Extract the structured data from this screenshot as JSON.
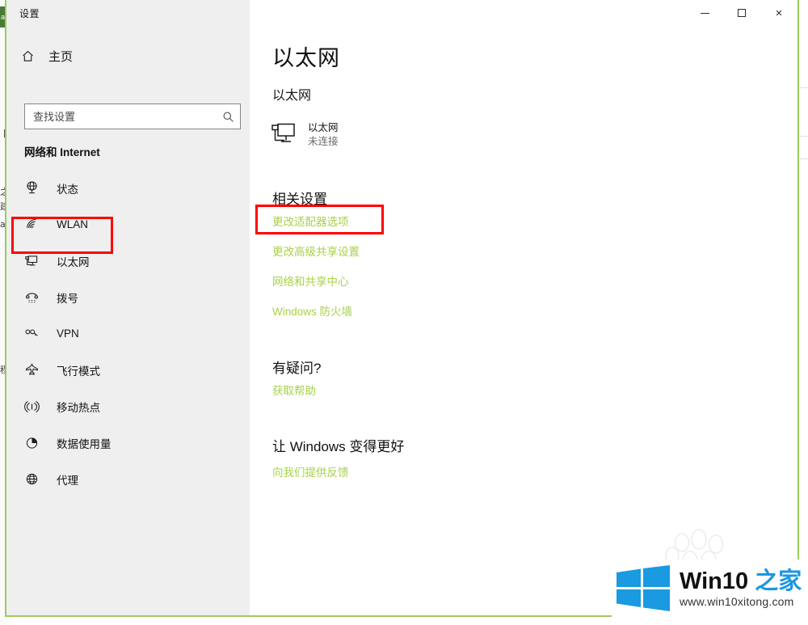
{
  "window": {
    "title": "设置",
    "controls": {
      "minimize": "最小化",
      "maximize": "最大化",
      "close": "关闭"
    },
    "border_color": "#9ccc5a"
  },
  "sidebar": {
    "home": {
      "label": "主页",
      "icon": "home-icon"
    },
    "search": {
      "placeholder": "查找设置",
      "value": "",
      "icon": "search-icon"
    },
    "group_title": "网络和 Internet",
    "items": [
      {
        "label": "状态",
        "icon": "status-globe-icon",
        "selected": false
      },
      {
        "label": "WLAN",
        "icon": "wifi-icon",
        "selected": false
      },
      {
        "label": "以太网",
        "icon": "ethernet-icon",
        "selected": true
      },
      {
        "label": "拨号",
        "icon": "dialup-phone-icon",
        "selected": false
      },
      {
        "label": "VPN",
        "icon": "vpn-key-icon",
        "selected": false
      },
      {
        "label": "飞行模式",
        "icon": "airplane-icon",
        "selected": false
      },
      {
        "label": "移动热点",
        "icon": "hotspot-icon",
        "selected": false
      },
      {
        "label": "数据使用量",
        "icon": "pie-chart-icon",
        "selected": false
      },
      {
        "label": "代理",
        "icon": "globe-icon",
        "selected": false
      }
    ]
  },
  "main": {
    "title": "以太网",
    "subtitle": "以太网",
    "device": {
      "icon": "ethernet-monitor-icon",
      "name": "以太网",
      "status": "未连接"
    },
    "related_settings": {
      "heading": "相关设置",
      "links": [
        "更改适配器选项",
        "更改高级共享设置",
        "网络和共享中心",
        "Windows 防火墙"
      ]
    },
    "questions": {
      "heading": "有疑问?",
      "links": [
        "获取帮助"
      ]
    },
    "improve": {
      "heading": "让 Windows 变得更好",
      "links": [
        "向我们提供反馈"
      ]
    },
    "link_color": "#a8d14a"
  },
  "annotations": [
    {
      "name": "highlight-ethernet-nav",
      "target": "以太网",
      "color": "#ff0000"
    },
    {
      "name": "highlight-change-adapter-link",
      "target": "更改适配器选项",
      "color": "#ff0000"
    }
  ],
  "watermark": {
    "brand_prefix": "Win10 ",
    "brand_suffix": "之家",
    "url": "www.win10xitong.com",
    "accent_color": "#1a97e0"
  },
  "background": {
    "fragments": [
      "a",
      "建",
      "之",
      "程",
      "卡"
    ]
  }
}
